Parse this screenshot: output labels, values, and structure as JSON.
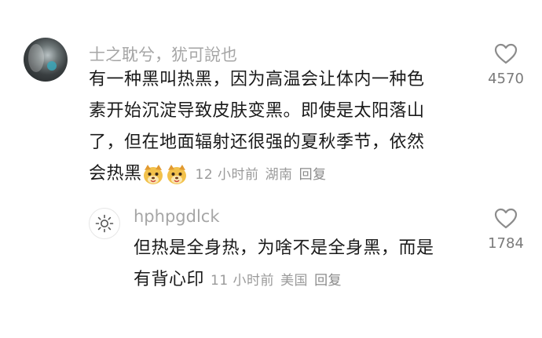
{
  "comment": {
    "username": "士之耽兮，犹可說也",
    "lines": [
      "有一种黑叫热黑，因为高温会让体内一种色",
      "素开始沉淀导致皮肤变黑。即使是太阳落山",
      "了，但在地面辐射还很强的夏秋季节，依然",
      "会热黑"
    ],
    "time": "12 小时前",
    "location": "湖南",
    "reply_label": "回复",
    "like_count": "4570"
  },
  "reply": {
    "username": "hphpgdlck",
    "lines": [
      "但热是全身热，为啥不是全身黑，而是",
      "有背心印"
    ],
    "time": "11 小时前",
    "location": "美国",
    "reply_label": "回复",
    "like_count": "1784"
  },
  "icons": {
    "avatar_main": "avatar-photo",
    "avatar_reply": "sun-icon",
    "like": "heart-outline-icon",
    "emoji": "dog-face-emoji"
  },
  "colors": {
    "username": "#a6a6a6",
    "text": "#1a1a1a",
    "meta": "#9a9a9a",
    "emoji": "#f2c14b"
  }
}
